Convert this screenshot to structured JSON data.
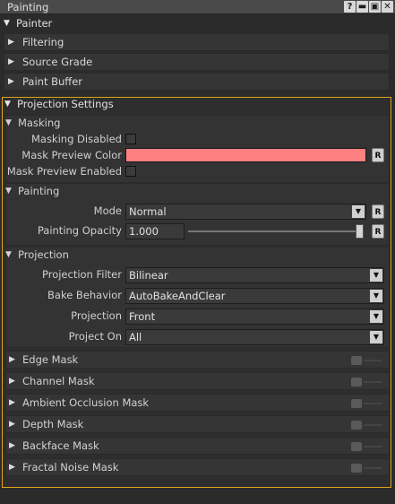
{
  "window": {
    "title": "Painting",
    "icons": [
      "help-icon",
      "minimize-icon",
      "float-icon",
      "close-icon"
    ],
    "icon_glyphs": [
      "?",
      "▬",
      "▣",
      "✕"
    ]
  },
  "panel": {
    "header": "Painter",
    "collapsed_sections": [
      "Filtering",
      "Source Grade",
      "Paint Buffer"
    ]
  },
  "projection_settings": {
    "header": "Projection Settings",
    "masking": {
      "header": "Masking",
      "masking_disabled_label": "Masking Disabled",
      "mask_preview_color_label": "Mask Preview Color",
      "mask_preview_color": "#fe8080",
      "mask_preview_enabled_label": "Mask Preview Enabled",
      "reset_label": "R"
    },
    "painting": {
      "header": "Painting",
      "mode_label": "Mode",
      "mode_value": "Normal",
      "opacity_label": "Painting Opacity",
      "opacity_value": "1.000",
      "opacity_fraction": 1.0,
      "reset_label": "R"
    },
    "projection": {
      "header": "Projection",
      "filter_label": "Projection Filter",
      "filter_value": "Bilinear",
      "bake_label": "Bake Behavior",
      "bake_value": "AutoBakeAndClear",
      "projection_label": "Projection",
      "projection_value": "Front",
      "project_on_label": "Project On",
      "project_on_value": "All"
    },
    "masks": [
      "Edge Mask",
      "Channel Mask",
      "Ambient Occlusion Mask",
      "Depth Mask",
      "Backface Mask",
      "Fractal Noise Mask"
    ]
  },
  "colors": {
    "accent_frame": "#e0a21b",
    "background": "#2b2b2b"
  }
}
